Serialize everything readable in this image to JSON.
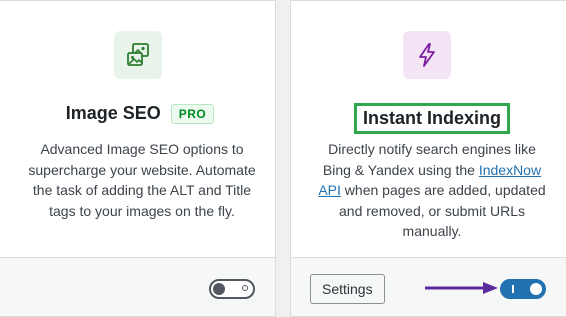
{
  "cards": [
    {
      "title": "Image SEO",
      "badge": "PRO",
      "description": "Advanced Image SEO options to supercharge your website. Automate the task of adding the ALT and Title tags to your images on the fly.",
      "icon": "image-gallery-icon",
      "enabled": false,
      "colors": {
        "icon_bg": "#e8f3ea",
        "icon": "#2e7d32"
      }
    },
    {
      "title": "Instant Indexing",
      "description_before": "Directly notify search engines like Bing & Yandex using the ",
      "description_link": "IndexNow API",
      "description_after": " when pages are added, updated and removed, or submit URLs manually.",
      "icon": "lightning-bolt-icon",
      "settings_label": "Settings",
      "enabled": true,
      "colors": {
        "icon_bg": "#f3e5f5",
        "icon": "#7b1fa2",
        "highlight": "#2fa84f",
        "arrow": "#5b2ca0",
        "toggle_on": "#2271b1"
      }
    }
  ]
}
